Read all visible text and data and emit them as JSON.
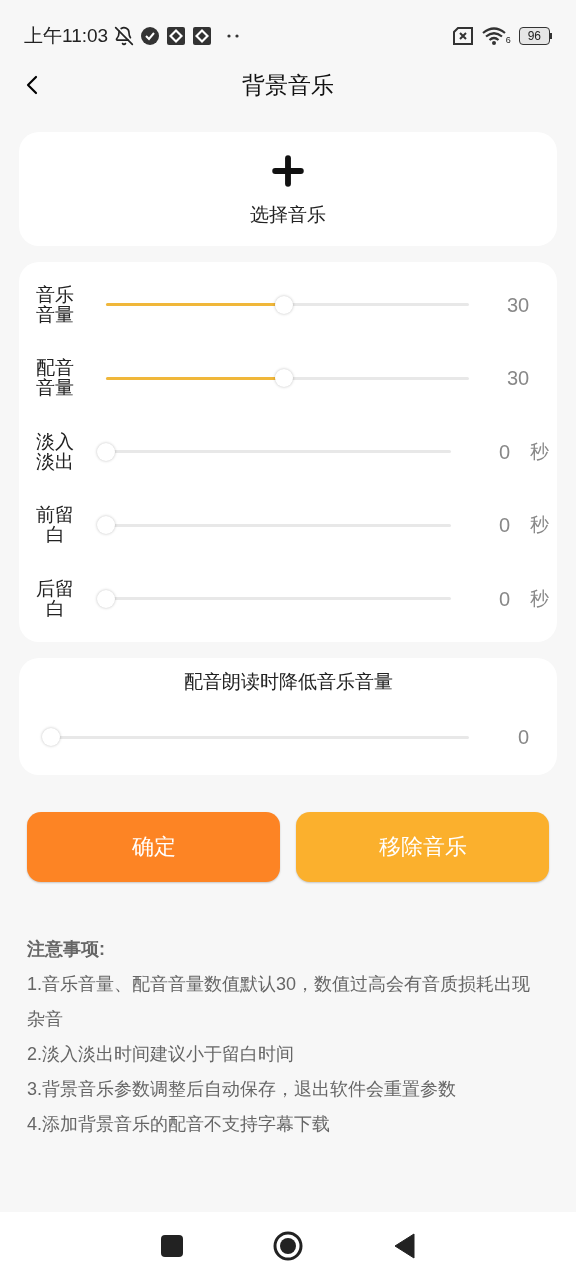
{
  "status_bar": {
    "time": "上午11:03",
    "wifi_label": "6",
    "battery": "96"
  },
  "header": {
    "title": "背景音乐"
  },
  "add_music": {
    "label": "选择音乐"
  },
  "sliders": [
    {
      "label": "音乐音量",
      "level": 0.49,
      "reading": "30"
    },
    {
      "label": "配音音量",
      "level": 0.49,
      "reading": "30"
    },
    {
      "label": "淡入淡出",
      "level": 0,
      "reading": "0",
      "unit": "秒"
    },
    {
      "label": "前留白",
      "level": 0,
      "reading": "0",
      "unit": "秒"
    },
    {
      "label": "后留白",
      "level": 0,
      "reading": "0",
      "unit": "秒"
    }
  ],
  "ducking": {
    "title": "配音朗读时降低音乐音量",
    "level": 0,
    "reading": "0"
  },
  "buttons": [
    {
      "label": "确定",
      "kind": "primary"
    },
    {
      "label": "移除音乐",
      "kind": "secondary"
    }
  ],
  "notes": {
    "title": "注意事项:",
    "items": [
      "1.音乐音量、配音音量数值默认30，数值过高会有音质损耗出现杂音",
      "2.淡入淡出时间建议小于留白时间",
      "3.背景音乐参数调整后自动保存，退出软件会重置参数",
      "4.添加背景音乐的配音不支持字幕下载"
    ]
  }
}
